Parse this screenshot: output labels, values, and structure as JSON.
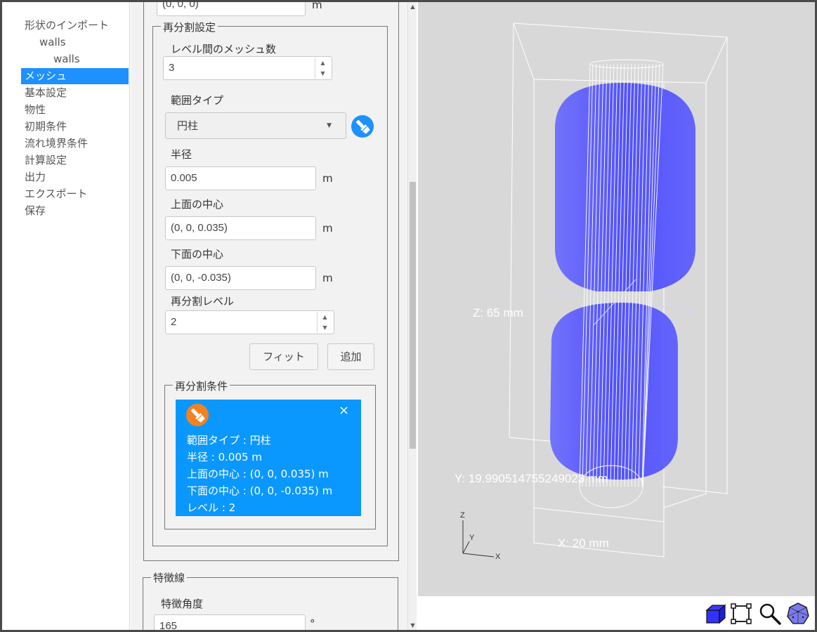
{
  "sidebar": {
    "items": [
      {
        "label": "形状のインポート",
        "level": 0,
        "active": false
      },
      {
        "label": "walls",
        "level": 1,
        "active": false
      },
      {
        "label": "walls",
        "level": 2,
        "active": false
      },
      {
        "label": "メッシュ",
        "level": 0,
        "active": true
      },
      {
        "label": "基本設定",
        "level": 0,
        "active": false
      },
      {
        "label": "物性",
        "level": 0,
        "active": false
      },
      {
        "label": "初期条件",
        "level": 0,
        "active": false
      },
      {
        "label": "流れ境界条件",
        "level": 0,
        "active": false
      },
      {
        "label": "計算設定",
        "level": 0,
        "active": false
      },
      {
        "label": "出力",
        "level": 0,
        "active": false
      },
      {
        "label": "エクスポート",
        "level": 0,
        "active": false
      },
      {
        "label": "保存",
        "level": 0,
        "active": false
      }
    ]
  },
  "top_field": {
    "value": "(0, 0, 0)",
    "unit": "m"
  },
  "refinement": {
    "legend": "再分割設定",
    "mesh_between_levels_label": "レベル間のメッシュ数",
    "mesh_between_levels_value": "3",
    "region_type_label": "範囲タイプ",
    "region_type_value": "円柱",
    "radius_label": "半径",
    "radius_value": "0.005",
    "radius_unit": "m",
    "top_center_label": "上面の中心",
    "top_center_value": "(0, 0, 0.035)",
    "top_center_unit": "m",
    "bottom_center_label": "下面の中心",
    "bottom_center_value": "(0, 0, -0.035)",
    "bottom_center_unit": "m",
    "level_label": "再分割レベル",
    "level_value": "2",
    "fit_button": "フィット",
    "add_button": "追加"
  },
  "conditions": {
    "legend": "再分割条件",
    "card": {
      "close": "×",
      "lines": [
        "範囲タイプ : 円柱",
        "半径 : 0.005 m",
        "上面の中心 : (0, 0, 0.035) m",
        "下面の中心 : (0, 0, -0.035) m",
        "レベル : 2"
      ]
    }
  },
  "feature_lines": {
    "legend": "特徴線",
    "angle_label": "特徴角度",
    "angle_value": "165",
    "angle_unit": "°"
  },
  "viewport": {
    "dim_z": "Z: 65 mm",
    "dim_y": "Y: 19.990514755249023 mm",
    "dim_x": "X: 20 mm",
    "axis_z": "Z",
    "axis_y": "Y",
    "axis_x": "X",
    "body_color": "#4a4aff",
    "accent_color": "#1e90ff"
  },
  "toolbar": {
    "icons": [
      "view-cube-icon",
      "fit-bounds-icon",
      "zoom-icon",
      "isometric-view-icon"
    ]
  }
}
